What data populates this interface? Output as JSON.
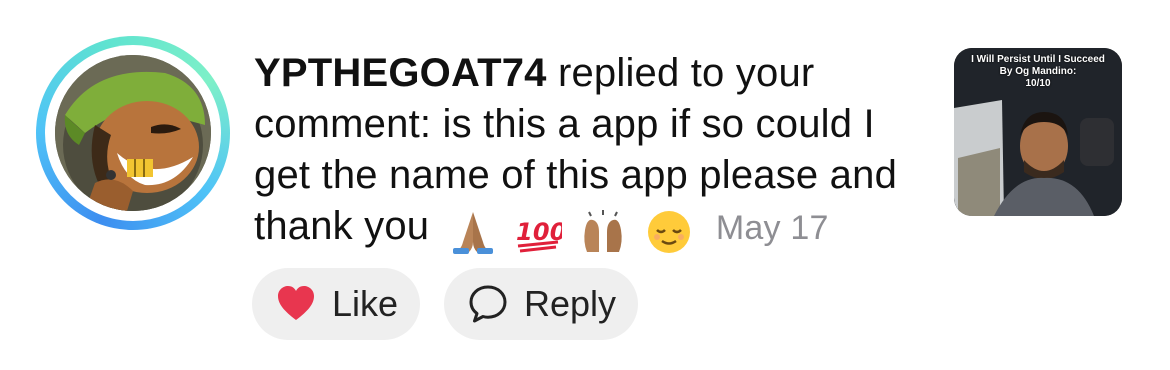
{
  "notification": {
    "username": "YPTHEGOAT74",
    "action_text": " replied to your comment: is this a app if so could I get the name of this app please and thank you",
    "emojis": [
      "praying-hands-emoji",
      "hundred-points-emoji",
      "raising-hands-emoji",
      "relieved-face-emoji"
    ],
    "timestamp": "May 17",
    "thumbnail_caption_line1": "I Will Persist Until I Succeed",
    "thumbnail_caption_line2": "By Og Mandino:",
    "thumbnail_caption_line3": "10/10"
  },
  "actions": {
    "like_label": "Like",
    "reply_label": "Reply"
  },
  "colors": {
    "heart": "#e8364f",
    "ring_start": "#3d8ef0",
    "ring_end": "#7ef0c8",
    "timestamp": "#8e8e93",
    "pill_bg": "#efefef"
  }
}
